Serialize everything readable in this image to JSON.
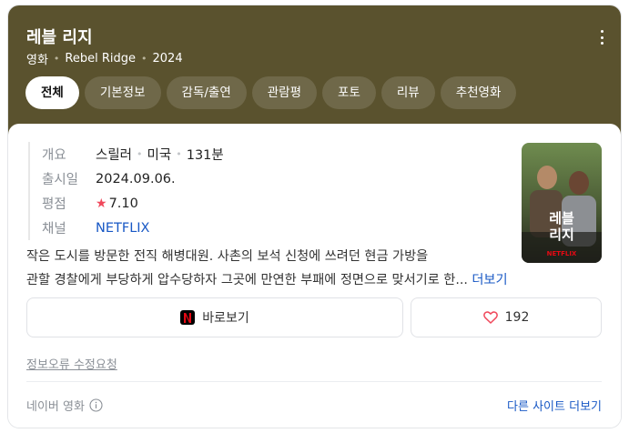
{
  "header": {
    "title": "레블 리지",
    "category": "영화",
    "original_title": "Rebel Ridge",
    "year": "2024",
    "background_color": "#5a522e"
  },
  "tabs": [
    {
      "label": "전체",
      "active": true
    },
    {
      "label": "기본정보",
      "active": false
    },
    {
      "label": "감독/출연",
      "active": false
    },
    {
      "label": "관람평",
      "active": false
    },
    {
      "label": "포토",
      "active": false
    },
    {
      "label": "리뷰",
      "active": false
    },
    {
      "label": "추천영화",
      "active": false
    }
  ],
  "info": {
    "overview_label": "개요",
    "genre": "스릴러",
    "country": "미국",
    "runtime": "131분",
    "release_label": "출시일",
    "release_date": "2024.09.06.",
    "rating_label": "평점",
    "rating": "7.10",
    "channel_label": "채널",
    "channel": "NETFLIX"
  },
  "poster": {
    "title_text": "레블\n리지",
    "badge": "NETFLIX"
  },
  "synopsis": {
    "line1": "작은 도시를 방문한 전직 해병대원. 사촌의 보석 신청에 쓰려던 현금 가방을",
    "line2": "관할 경찰에게 부당하게 압수당하자 그곳에 만연한 부패에 정면으로 맞서기로 한...",
    "more_label": "더보기"
  },
  "actions": {
    "watch_label": "바로보기",
    "like_count": "192"
  },
  "footer": {
    "report_label": "정보오류 수정요청",
    "source_label": "네이버 영화",
    "other_sites_label": "다른 사이트 더보기"
  },
  "colors": {
    "accent_link": "#1858c5",
    "star": "#f0485b",
    "netflix_red": "#e50914"
  },
  "icons": [
    "more-vertical-icon",
    "star-icon",
    "netflix-icon",
    "heart-icon",
    "info-icon"
  ]
}
